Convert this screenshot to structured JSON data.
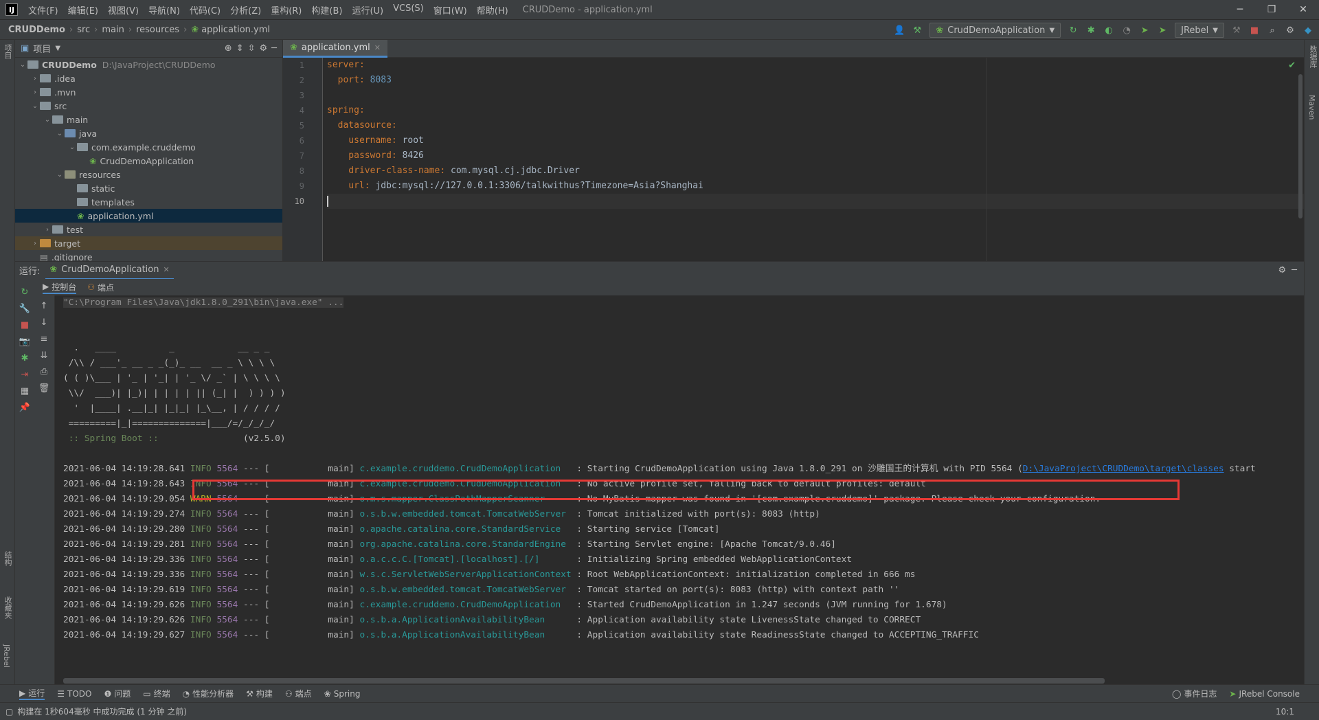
{
  "menubar": {
    "logo": "IJ",
    "items": [
      "文件(F)",
      "编辑(E)",
      "视图(V)",
      "导航(N)",
      "代码(C)",
      "分析(Z)",
      "重构(R)",
      "构建(B)",
      "运行(U)",
      "VCS(S)",
      "窗口(W)",
      "帮助(H)"
    ],
    "window_title": "CRUDDemo - application.yml"
  },
  "breadcrumb": [
    "CRUDDemo",
    "src",
    "main",
    "resources",
    "application.yml"
  ],
  "toolbar": {
    "run_config": "CrudDemoApplication",
    "jrebel": "JRebel"
  },
  "left_strip": {
    "project": "项目",
    "structure": "结构",
    "favorites": "收藏夹",
    "jrebel": "JRebel"
  },
  "right_strip": {
    "database": "数据库",
    "maven": "Maven"
  },
  "project_panel": {
    "title": "项目",
    "tree": [
      {
        "label": "CRUDDemo",
        "path": "D:\\JavaProject\\CRUDDemo",
        "depth": 0,
        "arrow": "v",
        "type": "module"
      },
      {
        "label": ".idea",
        "depth": 1,
        "arrow": ">",
        "type": "folder"
      },
      {
        "label": ".mvn",
        "depth": 1,
        "arrow": ">",
        "type": "folder"
      },
      {
        "label": "src",
        "depth": 1,
        "arrow": "v",
        "type": "folder"
      },
      {
        "label": "main",
        "depth": 2,
        "arrow": "v",
        "type": "folder"
      },
      {
        "label": "java",
        "depth": 3,
        "arrow": "v",
        "type": "src"
      },
      {
        "label": "com.example.cruddemo",
        "depth": 4,
        "arrow": "v",
        "type": "package"
      },
      {
        "label": "CrudDemoApplication",
        "depth": 5,
        "arrow": "",
        "type": "spring"
      },
      {
        "label": "resources",
        "depth": 3,
        "arrow": "v",
        "type": "res"
      },
      {
        "label": "static",
        "depth": 4,
        "arrow": "",
        "type": "folder"
      },
      {
        "label": "templates",
        "depth": 4,
        "arrow": "",
        "type": "folder"
      },
      {
        "label": "application.yml",
        "depth": 4,
        "arrow": "",
        "type": "yml",
        "selected": true
      },
      {
        "label": "test",
        "depth": 2,
        "arrow": ">",
        "type": "folder"
      },
      {
        "label": "target",
        "depth": 1,
        "arrow": ">",
        "type": "tgt",
        "highlight": true
      },
      {
        "label": ".gitignore",
        "depth": 1,
        "arrow": "",
        "type": "file"
      }
    ]
  },
  "editor": {
    "tab": "application.yml",
    "lines": [
      [
        {
          "t": "server:",
          "c": "k"
        }
      ],
      [
        {
          "t": "  port: ",
          "c": "k"
        },
        {
          "t": "8083",
          "c": "n"
        }
      ],
      [],
      [
        {
          "t": "spring:",
          "c": "k"
        }
      ],
      [
        {
          "t": "  datasource:",
          "c": "k"
        }
      ],
      [
        {
          "t": "    username: ",
          "c": "k"
        },
        {
          "t": "root",
          "c": ""
        }
      ],
      [
        {
          "t": "    password: ",
          "c": "k"
        },
        {
          "t": "8426",
          "c": ""
        }
      ],
      [
        {
          "t": "    driver-class-name: ",
          "c": "k"
        },
        {
          "t": "com.mysql.cj.jdbc.Driver",
          "c": ""
        }
      ],
      [
        {
          "t": "    url: ",
          "c": "k"
        },
        {
          "t": "jdbc:mysql://127.0.0.1:3306/talkwithus?Timezone=Asia?Shanghai",
          "c": ""
        }
      ],
      []
    ]
  },
  "run_panel": {
    "label": "运行:",
    "tab": "CrudDemoApplication",
    "subtabs": [
      "控制台",
      "端点"
    ]
  },
  "console": {
    "cmd": "\"C:\\Program Files\\Java\\jdk1.8.0_291\\bin\\java.exe\" ...",
    "banner": [
      "  .   ____          _            __ _ _",
      " /\\\\ / ___'_ __ _ _(_)_ __  __ _ \\ \\ \\ \\",
      "( ( )\\___ | '_ | '_| | '_ \\/ _` | \\ \\ \\ \\",
      " \\\\/  ___)| |_)| | | | | || (_| |  ) ) ) )",
      "  '  |____| .__|_| |_|_| |_\\__, | / / / /",
      " =========|_|==============|___/=/_/_/_/"
    ],
    "boot_label": " :: Spring Boot :: ",
    "boot_version": "               (v2.5.0)",
    "logs": [
      {
        "ts": "2021-06-04 14:19:28.641",
        "lvl": "INFO",
        "pid": "5564",
        "thr": " --- [           main] ",
        "cls": "c.example.cruddemo.CrudDemoApplication   ",
        "msg": ": Starting CrudDemoApplication using Java 1.8.0_291 on 沙雕国王的计算机 with PID 5564 (",
        "link": "D:\\JavaProject\\CRUDDemo\\target\\classes",
        "tail": " start"
      },
      {
        "ts": "2021-06-04 14:19:28.643",
        "lvl": "INFO",
        "pid": "5564",
        "thr": " --- [           main] ",
        "cls": "c.example.cruddemo.CrudDemoApplication   ",
        "msg": ": No active profile set, falling back to default profiles: default"
      },
      {
        "ts": "2021-06-04 14:19:29.054",
        "lvl": "WARN",
        "pid": "5564",
        "thr": " --- [           main] ",
        "cls": "o.m.s.mapper.ClassPathMapperScanner      ",
        "msg": ": No MyBatis mapper was found in '[com.example.cruddemo]' package. Please check your configuration."
      },
      {
        "ts": "2021-06-04 14:19:29.274",
        "lvl": "INFO",
        "pid": "5564",
        "thr": " --- [           main] ",
        "cls": "o.s.b.w.embedded.tomcat.TomcatWebServer  ",
        "msg": ": Tomcat initialized with port(s): 8083 (http)"
      },
      {
        "ts": "2021-06-04 14:19:29.280",
        "lvl": "INFO",
        "pid": "5564",
        "thr": " --- [           main] ",
        "cls": "o.apache.catalina.core.StandardService   ",
        "msg": ": Starting service [Tomcat]"
      },
      {
        "ts": "2021-06-04 14:19:29.281",
        "lvl": "INFO",
        "pid": "5564",
        "thr": " --- [           main] ",
        "cls": "org.apache.catalina.core.StandardEngine  ",
        "msg": ": Starting Servlet engine: [Apache Tomcat/9.0.46]"
      },
      {
        "ts": "2021-06-04 14:19:29.336",
        "lvl": "INFO",
        "pid": "5564",
        "thr": " --- [           main] ",
        "cls": "o.a.c.c.C.[Tomcat].[localhost].[/]       ",
        "msg": ": Initializing Spring embedded WebApplicationContext"
      },
      {
        "ts": "2021-06-04 14:19:29.336",
        "lvl": "INFO",
        "pid": "5564",
        "thr": " --- [           main] ",
        "cls": "w.s.c.ServletWebServerApplicationContext ",
        "msg": ": Root WebApplicationContext: initialization completed in 666 ms"
      },
      {
        "ts": "2021-06-04 14:19:29.619",
        "lvl": "INFO",
        "pid": "5564",
        "thr": " --- [           main] ",
        "cls": "o.s.b.w.embedded.tomcat.TomcatWebServer  ",
        "msg": ": Tomcat started on port(s): 8083 (http) with context path ''"
      },
      {
        "ts": "2021-06-04 14:19:29.626",
        "lvl": "INFO",
        "pid": "5564",
        "thr": " --- [           main] ",
        "cls": "c.example.cruddemo.CrudDemoApplication   ",
        "msg": ": Started CrudDemoApplication in 1.247 seconds (JVM running for 1.678)"
      },
      {
        "ts": "2021-06-04 14:19:29.626",
        "lvl": "INFO",
        "pid": "5564",
        "thr": " --- [           main] ",
        "cls": "o.s.b.a.ApplicationAvailabilityBean      ",
        "msg": ": Application availability state LivenessState changed to CORRECT"
      },
      {
        "ts": "2021-06-04 14:19:29.627",
        "lvl": "INFO",
        "pid": "5564",
        "thr": " --- [           main] ",
        "cls": "o.s.b.a.ApplicationAvailabilityBean      ",
        "msg": ": Application availability state ReadinessState changed to ACCEPTING_TRAFFIC"
      }
    ]
  },
  "bottom_tabs": [
    "运行",
    "TODO",
    "问题",
    "终端",
    "性能分析器",
    "构建",
    "端点",
    "Spring"
  ],
  "bottom_right": [
    "事件日志",
    "JRebel Console"
  ],
  "status": {
    "message": "构建在 1秒604毫秒 中成功完成 (1 分钟 之前)",
    "position": "10:1"
  },
  "colors": {
    "accent": "#4a88c7",
    "warn_box": "#e53935",
    "bg": "#2b2b2b",
    "panel": "#3c3f41"
  }
}
